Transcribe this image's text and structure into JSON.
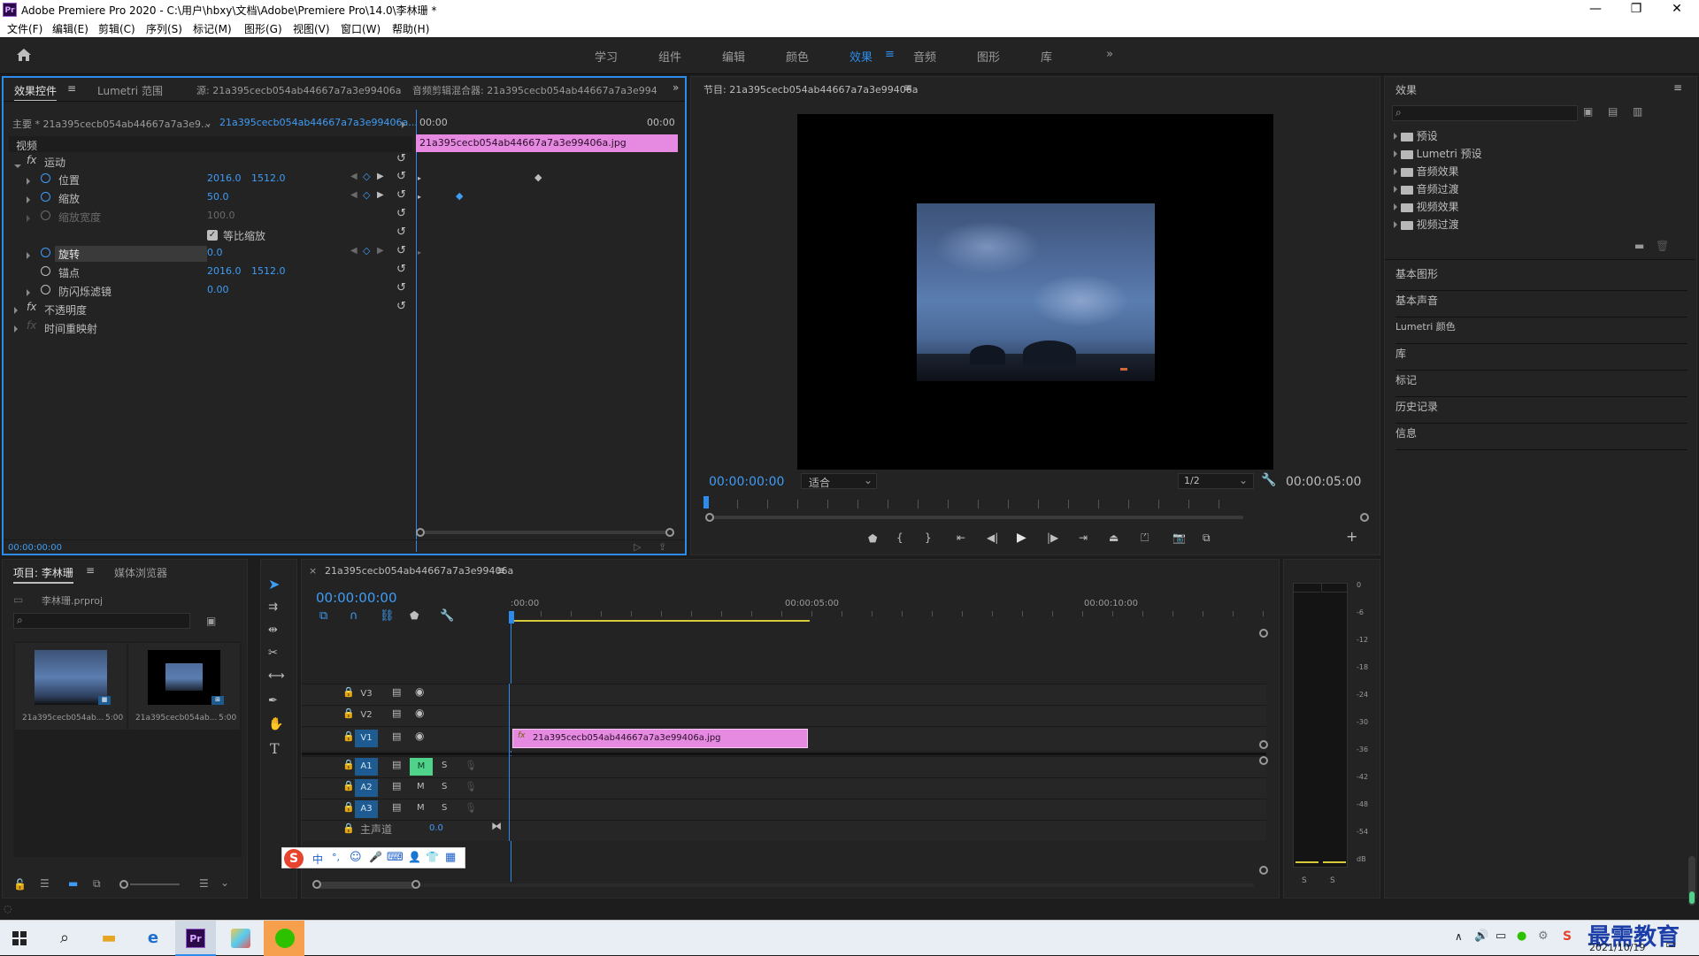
{
  "window": {
    "title": "Adobe Premiere Pro 2020 - C:\\用户\\hbxy\\文档\\Adobe\\Premiere Pro\\14.0\\李林珊 *",
    "logo": "Pr"
  },
  "menu": [
    "文件(F)",
    "编辑(E)",
    "剪辑(C)",
    "序列(S)",
    "标记(M)",
    "图形(G)",
    "视图(V)",
    "窗口(W)",
    "帮助(H)"
  ],
  "workspaces": [
    "学习",
    "组件",
    "编辑",
    "颜色",
    "效果",
    "音频",
    "图形",
    "库"
  ],
  "active_workspace": "效果",
  "effect_controls": {
    "tabs": [
      "效果控件",
      "Lumetri 范围",
      "源: 21a395cecb054ab44667a7a3e99406a",
      "音频剪辑混合器: 21a395cecb054ab44667a7a3e9940"
    ],
    "master_label": "主要 * 21a395cecb054ab44667a7a3e9...",
    "clip_label": "21a395cecb054ab44667a7a3e99406a...",
    "time_start": "00:00",
    "time_end": "00:00",
    "clip_bar": "21a395cecb054ab44667a7a3e99406a.jpg",
    "section_video": "视频",
    "motion": "运动",
    "properties": [
      {
        "name": "位置",
        "v1": "2016.0",
        "v2": "1512.0"
      },
      {
        "name": "缩放",
        "v1": "50.0",
        "v2": ""
      },
      {
        "name": "缩放宽度",
        "v1": "100.0",
        "v2": ""
      },
      {
        "name": "等比缩放",
        "v1": "",
        "v2": ""
      },
      {
        "name": "旋转",
        "v1": "0.0",
        "v2": ""
      },
      {
        "name": "锚点",
        "v1": "2016.0",
        "v2": "1512.0"
      },
      {
        "name": "防闪烁滤镜",
        "v1": "0.00",
        "v2": ""
      }
    ],
    "opacity": "不透明度",
    "time_remap": "时间重映射",
    "current_time": "00:00:00:00"
  },
  "program_monitor": {
    "title": "节目: 21a395cecb054ab44667a7a3e99406a",
    "timecode": "00:00:00:00",
    "fit": "适合",
    "resolution": "1/2",
    "duration": "00:00:05:00"
  },
  "effects_panel": {
    "title": "效果",
    "tree": [
      "预设",
      "Lumetri 预设",
      "音频效果",
      "音频过渡",
      "视频效果",
      "视频过渡"
    ],
    "sections": [
      "基本图形",
      "基本声音",
      "Lumetri 颜色",
      "库",
      "标记",
      "历史记录",
      "信息"
    ]
  },
  "project_panel": {
    "tabs": [
      "项目: 李林珊",
      "媒体浏览器"
    ],
    "project_file": "李林珊.prproj",
    "items": [
      {
        "name": "21a395cecb054ab...",
        "duration": "5:00"
      },
      {
        "name": "21a395cecb054ab...",
        "duration": "5:00"
      }
    ]
  },
  "timeline": {
    "tab": "21a395cecb054ab44667a7a3e99406a",
    "timecode": "00:00:00:00",
    "ruler": [
      ":00:00",
      "00:00:05:00",
      "00:00:10:00"
    ],
    "tracks_video": [
      "V3",
      "V2",
      "V1"
    ],
    "tracks_audio": [
      "A1",
      "A2",
      "A3"
    ],
    "master": "主声道",
    "master_value": "0.0",
    "clip": "21a395cecb054ab44667a7a3e99406a.jpg",
    "mute": "M",
    "solo": "S"
  },
  "audio_meter": {
    "scale": [
      "0",
      "-6",
      "-12",
      "-18",
      "-24",
      "-30",
      "-36",
      "-42",
      "-48",
      "-54",
      "dB"
    ],
    "solo_labels": [
      "S",
      "S"
    ]
  },
  "ime_toolbar": [
    "中",
    "°,",
    "☺",
    "🎤",
    "⌨",
    "👤",
    "👕",
    "▦"
  ],
  "taskbar": {
    "date": "2021/10/19",
    "watermark": "最需教育"
  },
  "colors": {
    "accent": "#2d8ceb",
    "clip": "#e58ae0",
    "panel": "#232323"
  }
}
